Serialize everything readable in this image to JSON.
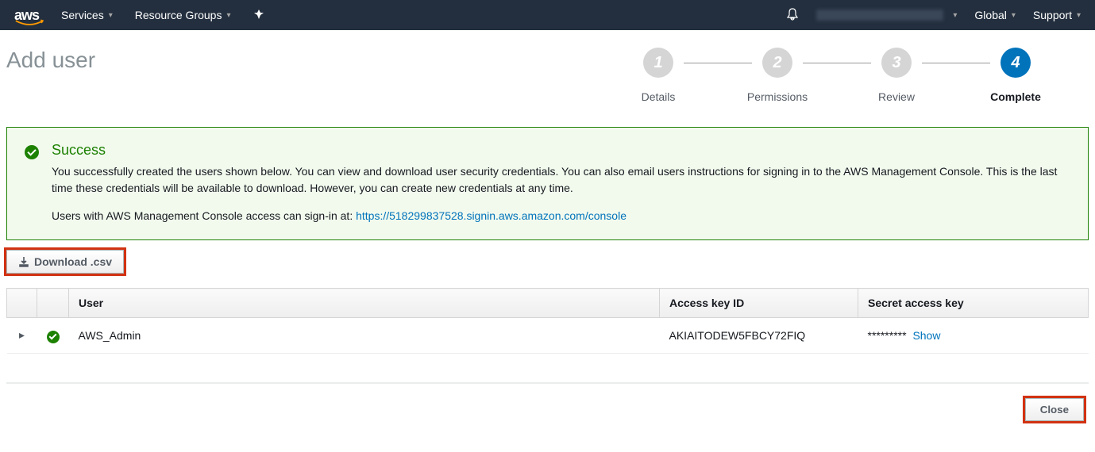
{
  "nav": {
    "logo": "aws",
    "services": "Services",
    "resource_groups": "Resource Groups",
    "region": "Global",
    "support": "Support"
  },
  "page_title": "Add user",
  "steps": [
    {
      "num": "1",
      "label": "Details"
    },
    {
      "num": "2",
      "label": "Permissions"
    },
    {
      "num": "3",
      "label": "Review"
    },
    {
      "num": "4",
      "label": "Complete"
    }
  ],
  "active_step_index": 3,
  "success": {
    "title": "Success",
    "body": "You successfully created the users shown below. You can view and download user security credentials. You can also email users instructions for signing in to the AWS Management Console. This is the last time these credentials will be available to download. However, you can create new credentials at any time.",
    "signin_prefix": "Users with AWS Management Console access can sign-in at: ",
    "signin_url": "https://518299837528.signin.aws.amazon.com/console"
  },
  "buttons": {
    "download_csv": "Download .csv",
    "close": "Close"
  },
  "table": {
    "headers": {
      "user": "User",
      "access_key_id": "Access key ID",
      "secret_access_key": "Secret access key"
    },
    "rows": [
      {
        "user": "AWS_Admin",
        "access_key_id": "AKIAITODEW5FBCY72FIQ",
        "secret_masked": "*********",
        "show_label": "Show"
      }
    ]
  }
}
